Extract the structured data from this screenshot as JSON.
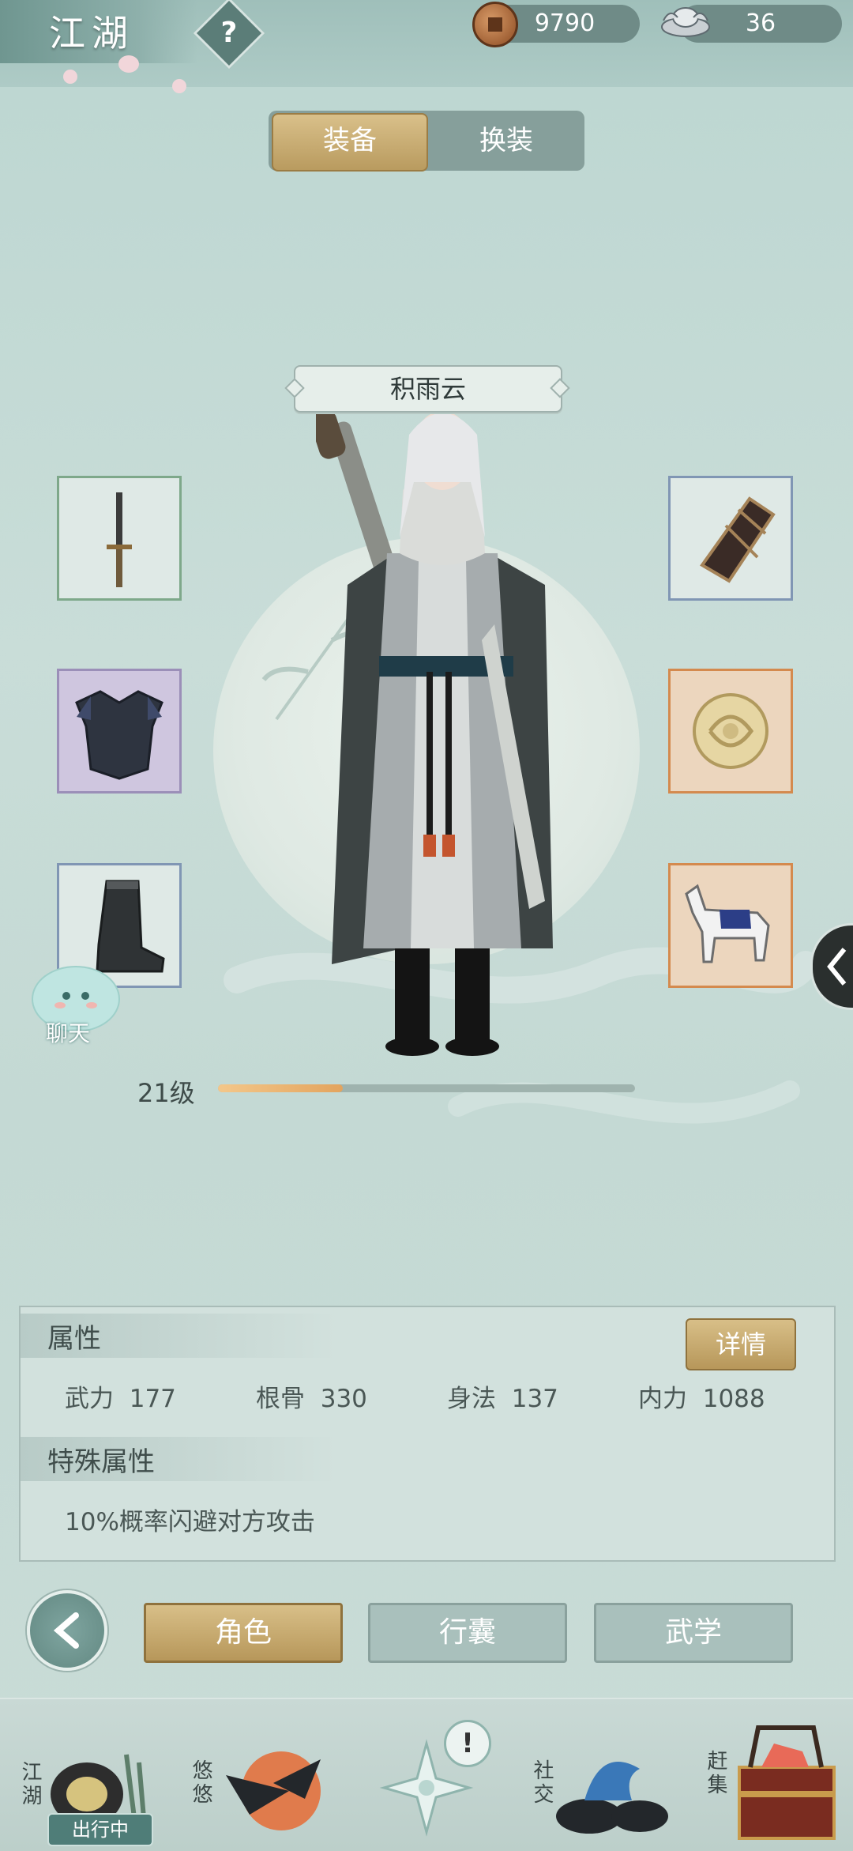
{
  "header": {
    "title": "江湖",
    "help_symbol": "?",
    "currency": [
      {
        "icon": "copper-coin-icon",
        "value": "9790"
      },
      {
        "icon": "silver-ingot-icon",
        "value": "36"
      }
    ]
  },
  "view_tabs": [
    {
      "label": "装备",
      "active": true
    },
    {
      "label": "换装",
      "active": false
    }
  ],
  "character": {
    "name": "积雨云",
    "level": "21级",
    "level_progress": 0.3
  },
  "equipment": {
    "left": [
      {
        "name": "weapon-slot",
        "icon": "sword-icon",
        "rarity": "green"
      },
      {
        "name": "armor-slot",
        "icon": "chest-armor-icon",
        "rarity": "purple"
      },
      {
        "name": "boots-slot",
        "icon": "boots-icon",
        "rarity": "blue"
      }
    ],
    "right": [
      {
        "name": "bracer-slot",
        "icon": "bracer-icon",
        "rarity": "blue"
      },
      {
        "name": "jade-slot",
        "icon": "jade-pendant-icon",
        "rarity": "orange"
      },
      {
        "name": "mount-slot",
        "icon": "horse-icon",
        "rarity": "orange"
      }
    ]
  },
  "chat": {
    "label": "聊天"
  },
  "attributes": {
    "title": "属性",
    "detail_button": "详情",
    "stats": [
      {
        "label": "武力",
        "value": "177"
      },
      {
        "label": "根骨",
        "value": "330"
      },
      {
        "label": "身法",
        "value": "137"
      },
      {
        "label": "内力",
        "value": "1088"
      }
    ],
    "special_title": "特殊属性",
    "special_text": "10%概率闪避对方攻击"
  },
  "bottom_tabs": [
    {
      "label": "角色",
      "active": true
    },
    {
      "label": "行囊",
      "active": false
    },
    {
      "label": "武学",
      "active": false
    }
  ],
  "nav": [
    {
      "label": "江湖",
      "badge": "出行中"
    },
    {
      "label": "悠悠"
    },
    {
      "label": "",
      "icon": "compass-star-icon",
      "alert": "!"
    },
    {
      "label": "社交"
    },
    {
      "label": "赶集"
    }
  ],
  "colors": {
    "gold": "#b99b5f",
    "teal": "#6f918b",
    "orange_rarity": "#d48a4e",
    "level_fill": "#e3a45e"
  }
}
